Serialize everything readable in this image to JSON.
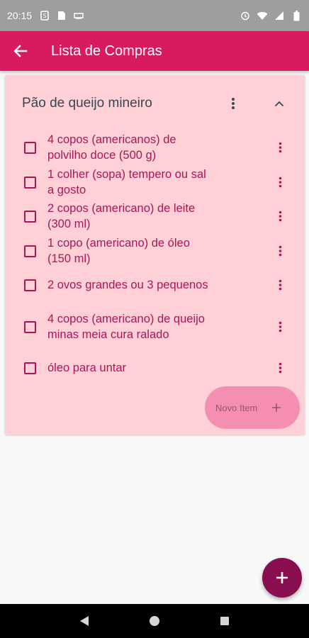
{
  "status_bar": {
    "time": "20:15",
    "left_icons": [
      "sim-icon",
      "document-icon",
      "cast-icon"
    ],
    "right_icons": [
      "alarm-icon",
      "wifi-icon",
      "signal-icon",
      "battery-icon"
    ]
  },
  "app_bar": {
    "title": "Lista de Compras",
    "color": "#d81b60"
  },
  "card": {
    "title": "Pão de queijo mineiro",
    "background": "#ffd1d6",
    "items": [
      {
        "text": "4 copos (americanos) de polvilho doce (500 g)",
        "checked": false
      },
      {
        "text": "1 colher (sopa) tempero ou sal a gosto",
        "checked": false
      },
      {
        "text": "2 copos (americano) de leite (300 ml)",
        "checked": false
      },
      {
        "text": "1 copo (americano) de óleo (150 ml)",
        "checked": false
      },
      {
        "text": "2 ovos grandes ou 3 pequenos",
        "checked": false
      },
      {
        "text": "4 copos (americano) de queijo minas meia cura ralado",
        "checked": false
      },
      {
        "text": "óleo para untar",
        "checked": false
      }
    ],
    "new_item_label": "Novo Item"
  },
  "fab": {
    "icon": "plus-icon",
    "color": "#880e4f"
  }
}
